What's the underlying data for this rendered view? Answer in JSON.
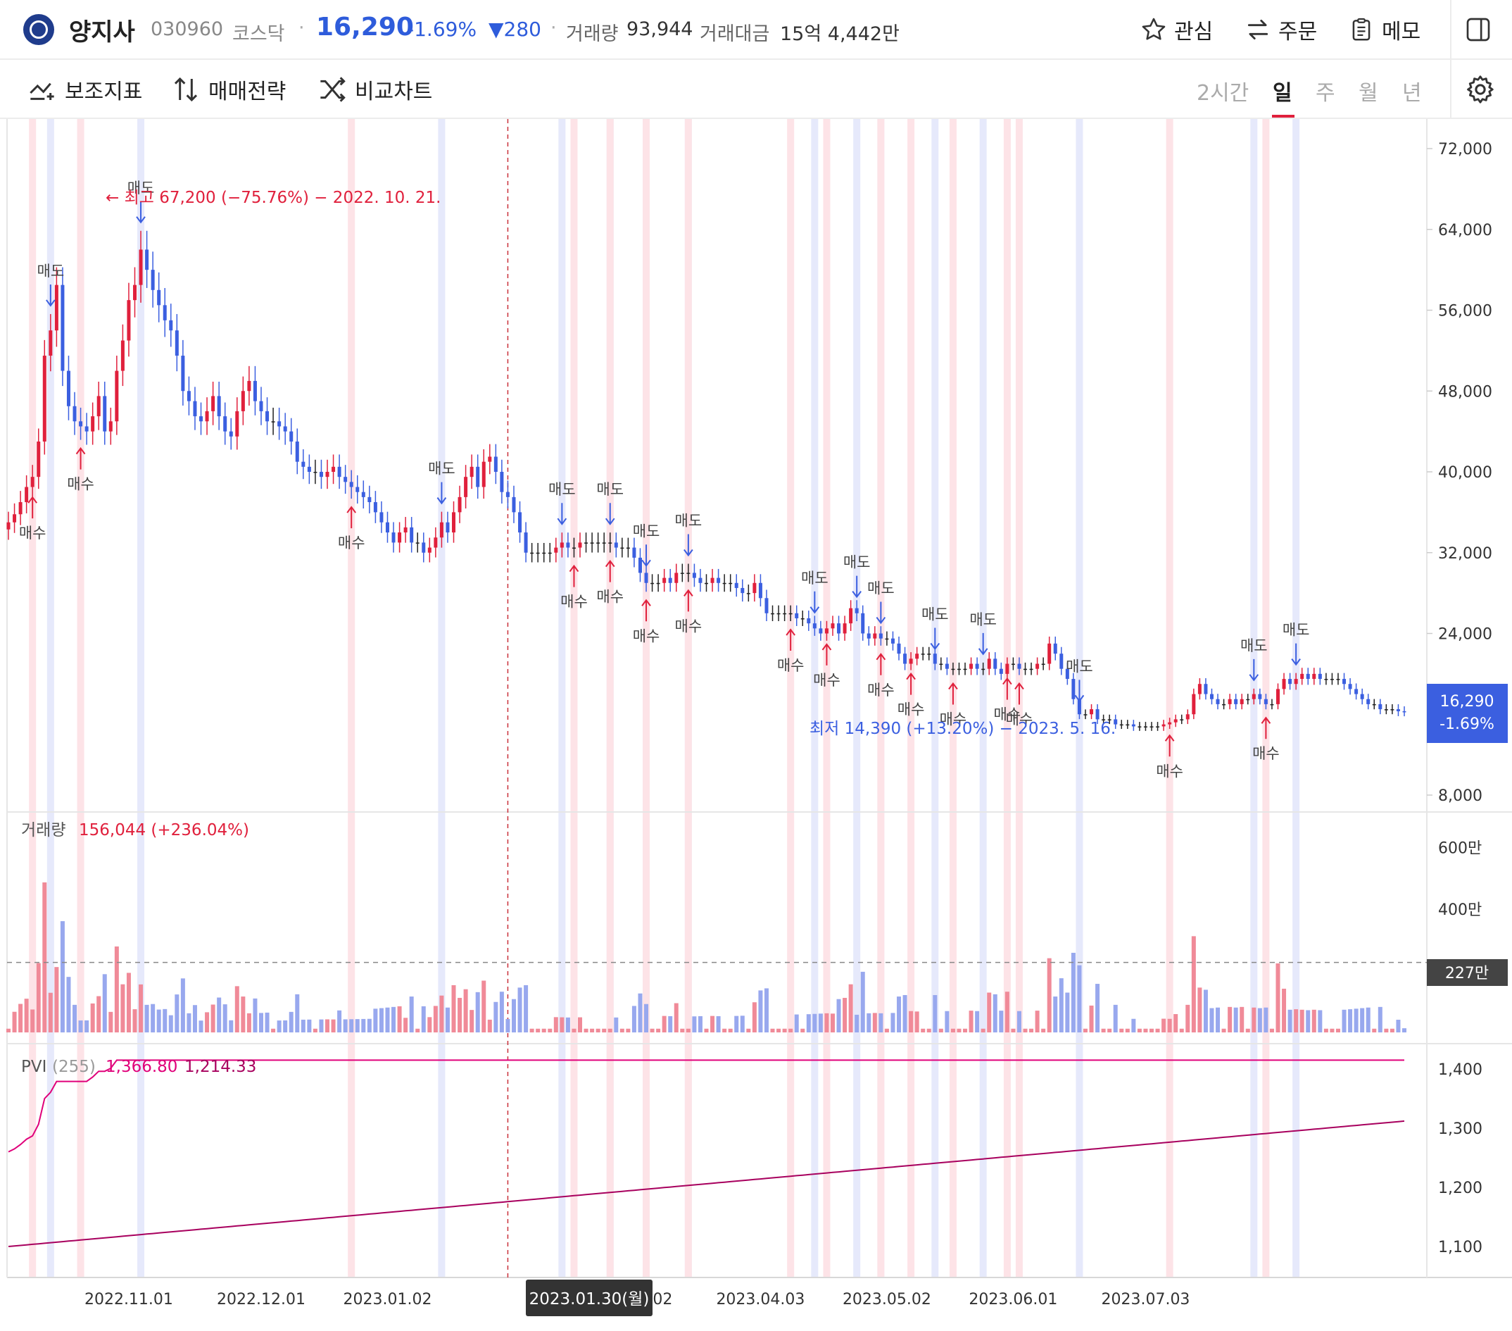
{
  "header": {
    "name": "양지사",
    "code": "030960",
    "market": "코스닥",
    "price": "16,290",
    "change_pct": "-1.69%",
    "change_abs": "▼280",
    "volume_label": "거래량",
    "volume_value": "93,944",
    "amount_label": "거래대금",
    "amount_value": "15억 4,442만",
    "btn_watch": "관심",
    "btn_order": "주문",
    "btn_memo": "메모"
  },
  "toolbar": {
    "indicator": "보조지표",
    "strategy": "매매전략",
    "compare": "비교차트",
    "periods": [
      "2시간",
      "일",
      "주",
      "월",
      "년"
    ],
    "active_period": "일"
  },
  "colors": {
    "up": "#e0203c",
    "down": "#3b5fe0",
    "accent": "#3b5fe0",
    "pvi": "#e0007a",
    "pvi_signal": "#a8005e"
  },
  "chart_data": {
    "type": "candlestick",
    "price_axis": {
      "ticks": [
        "72,000",
        "64,000",
        "56,000",
        "48,000",
        "40,000",
        "32,000",
        "24,000",
        "8,000"
      ],
      "range": [
        7000,
        74000
      ]
    },
    "x_ticks": [
      "2022.11.01",
      "2022.12.01",
      "2023.01.02",
      "2023.03.02",
      "2023.04.03",
      "2023.05.02",
      "2023.06.01",
      "2023.07.03"
    ],
    "crosshair_date": "2023.01.30(월)",
    "last_price_label": "16,290",
    "last_change_label": "-1.69%",
    "high_annotation": "← 최고 67,200 (−75.76%) − 2022. 10. 21.",
    "low_annotation": "최저 14,390 (+13.20%) − 2023. 5. 16.",
    "closes": [
      35000,
      35800,
      37000,
      38500,
      39500,
      43000,
      51500,
      54000,
      58500,
      50000,
      46500,
      45000,
      44500,
      44000,
      45500,
      47500,
      44000,
      45000,
      50000,
      53000,
      57000,
      58500,
      62000,
      60000,
      58000,
      56500,
      55000,
      54000,
      51500,
      48000,
      47000,
      45500,
      45000,
      46000,
      47500,
      45500,
      44000,
      43500,
      46000,
      48000,
      49000,
      47000,
      46000,
      45000,
      45000,
      44500,
      44000,
      43000,
      41000,
      40500,
      40000,
      40000,
      39500,
      40000,
      40500,
      39500,
      39000,
      38500,
      38000,
      37500,
      37000,
      36000,
      35000,
      34000,
      33000,
      34000,
      34500,
      33000,
      33000,
      32000,
      32500,
      33500,
      35000,
      34000,
      36000,
      37500,
      39500,
      40500,
      38500,
      41000,
      41500,
      40000,
      38000,
      37500,
      36000,
      34000,
      32000,
      32000,
      32000,
      32000,
      32000,
      32500,
      33000,
      32500,
      32500,
      33000,
      33000,
      33000,
      33000,
      33000,
      33000,
      32500,
      32500,
      32500,
      31500,
      30000,
      29000,
      29000,
      29000,
      29500,
      29000,
      30000,
      30000,
      30000,
      29500,
      29000,
      29000,
      29500,
      29000,
      29000,
      29000,
      28500,
      28000,
      28000,
      29000,
      27500,
      26000,
      26000,
      26000,
      26000,
      26000,
      25500,
      25500,
      25000,
      24500,
      24000,
      24500,
      25000,
      24000,
      25000,
      26500,
      26000,
      24000,
      23500,
      24000,
      23500,
      23500,
      23000,
      22000,
      21000,
      21500,
      22000,
      22000,
      22000,
      21000,
      21000,
      20500,
      20500,
      20500,
      20500,
      21000,
      20500,
      20500,
      21500,
      20500,
      20000,
      21000,
      21000,
      20500,
      20500,
      20500,
      21000,
      21000,
      23000,
      22000,
      20500,
      19500,
      17500,
      16000,
      16000,
      16500,
      15500,
      15500,
      15500,
      15000,
      15000,
      15000,
      14800,
      14800,
      14800,
      14800,
      14800,
      15000,
      15200,
      15500,
      15500,
      16000,
      18000,
      19000,
      18000,
      17500,
      17000,
      17000,
      17500,
      17000,
      17500,
      17500,
      18000,
      17500,
      17000,
      17000,
      18500,
      19500,
      19000,
      19500,
      20000,
      19500,
      20000,
      19500,
      19500,
      19500,
      19500,
      19000,
      18500,
      18000,
      17500,
      17000,
      17000,
      16500,
      16500,
      16500,
      16300,
      16290
    ],
    "volume_axis": {
      "ticks": [
        "600만",
        "400만"
      ],
      "range": [
        0,
        660
      ],
      "reference": "227만"
    },
    "volume_label": "거래량",
    "volume_value": "156,044 (+236.04%)",
    "pvi_axis": {
      "ticks": [
        "1,400",
        "1,300",
        "1,200",
        "1,100"
      ],
      "range": [
        1060,
        1430
      ]
    },
    "pvi_label": "PVI",
    "pvi_period": "(255)",
    "pvi_value1": "1,366.80",
    "pvi_value2": "1,214.33",
    "signals": [
      {
        "i": 4,
        "type": "buy"
      },
      {
        "i": 12,
        "type": "buy"
      },
      {
        "i": 7,
        "type": "sell"
      },
      {
        "i": 22,
        "type": "sell"
      },
      {
        "i": 57,
        "type": "buy"
      },
      {
        "i": 72,
        "type": "sell"
      },
      {
        "i": 92,
        "type": "sell"
      },
      {
        "i": 94,
        "type": "buy"
      },
      {
        "i": 100,
        "type": "sell"
      },
      {
        "i": 100,
        "type": "buy"
      },
      {
        "i": 106,
        "type": "sell"
      },
      {
        "i": 106,
        "type": "buy"
      },
      {
        "i": 113,
        "type": "sell"
      },
      {
        "i": 113,
        "type": "buy"
      },
      {
        "i": 130,
        "type": "buy"
      },
      {
        "i": 134,
        "type": "sell"
      },
      {
        "i": 136,
        "type": "buy"
      },
      {
        "i": 141,
        "type": "sell"
      },
      {
        "i": 145,
        "type": "sell"
      },
      {
        "i": 145,
        "type": "buy"
      },
      {
        "i": 150,
        "type": "buy"
      },
      {
        "i": 154,
        "type": "sell"
      },
      {
        "i": 157,
        "type": "buy"
      },
      {
        "i": 162,
        "type": "sell"
      },
      {
        "i": 166,
        "type": "buy"
      },
      {
        "i": 168,
        "type": "buy"
      },
      {
        "i": 178,
        "type": "sell"
      },
      {
        "i": 193,
        "type": "buy"
      },
      {
        "i": 207,
        "type": "sell"
      },
      {
        "i": 209,
        "type": "buy"
      },
      {
        "i": 214,
        "type": "sell"
      }
    ],
    "buy_label": "매수",
    "sell_label": "매도"
  }
}
